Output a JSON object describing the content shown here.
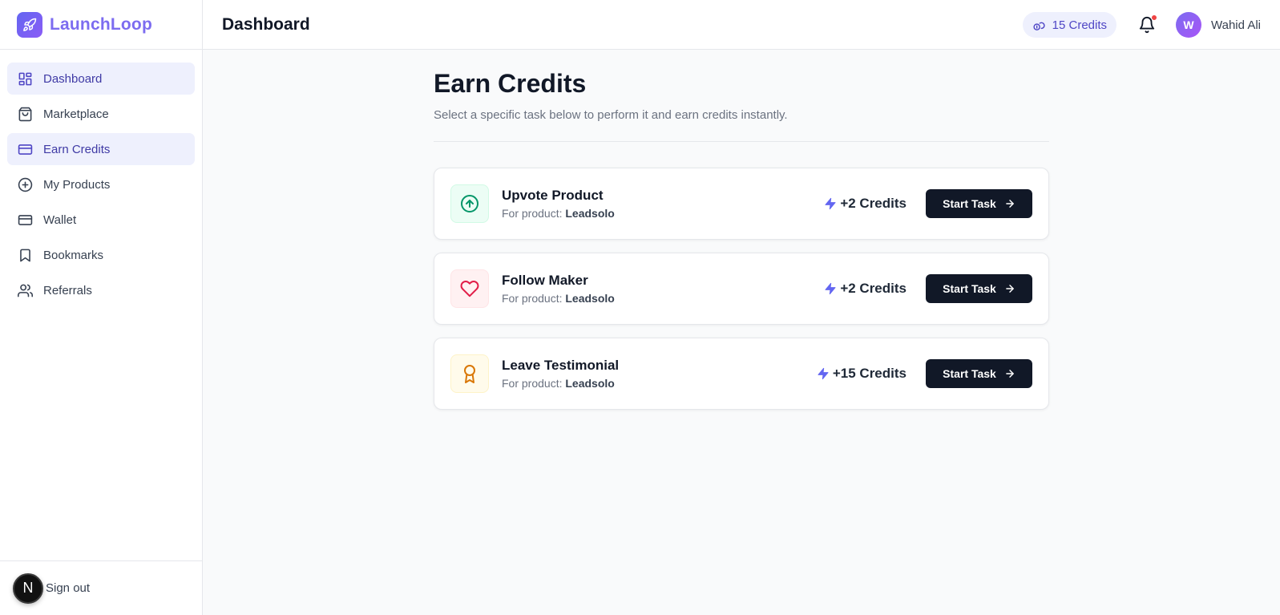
{
  "brand": {
    "name": "LaunchLoop",
    "logo_icon": "rocket-icon"
  },
  "header": {
    "title": "Dashboard",
    "credits_label": "15 Credits",
    "credits_icon": "coins-icon",
    "bell_icon": "bell-icon",
    "user": {
      "initial": "W",
      "name": "Wahid Ali"
    }
  },
  "sidebar": {
    "items": [
      {
        "label": "Dashboard",
        "icon": "layout-grid-icon",
        "active": true
      },
      {
        "label": "Marketplace",
        "icon": "shopping-bag-icon",
        "active": false
      },
      {
        "label": "Earn Credits",
        "icon": "credit-card-icon",
        "active": true
      },
      {
        "label": "My Products",
        "icon": "plus-circle-icon",
        "active": false
      },
      {
        "label": "Wallet",
        "icon": "wallet-icon",
        "active": false
      },
      {
        "label": "Bookmarks",
        "icon": "bookmark-icon",
        "active": false
      },
      {
        "label": "Referrals",
        "icon": "users-icon",
        "active": false
      }
    ],
    "footer": {
      "avatar_letter": "N",
      "signout_label": "Sign out"
    }
  },
  "main": {
    "title": "Earn Credits",
    "subtitle": "Select a specific task below to perform it and earn credits instantly.",
    "tasks": [
      {
        "title": "Upvote Product",
        "product_prefix": "For product:",
        "product": "Leadsolo",
        "reward": "+2 Credits",
        "button": "Start Task",
        "icon": "arrow-up-circle-icon",
        "color": "#059669"
      },
      {
        "title": "Follow Maker",
        "product_prefix": "For product:",
        "product": "Leadsolo",
        "reward": "+2 Credits",
        "button": "Start Task",
        "icon": "heart-icon",
        "color": "#e11d48"
      },
      {
        "title": "Leave Testimonial",
        "product_prefix": "For product:",
        "product": "Leadsolo",
        "reward": "+15 Credits",
        "button": "Start Task",
        "icon": "award-icon",
        "color": "#d97706"
      }
    ]
  },
  "colors": {
    "accent": "#4f46c5",
    "brand_gradient_start": "#6366f1",
    "button_dark": "#111827",
    "reward_bolt": "#6366f1"
  }
}
